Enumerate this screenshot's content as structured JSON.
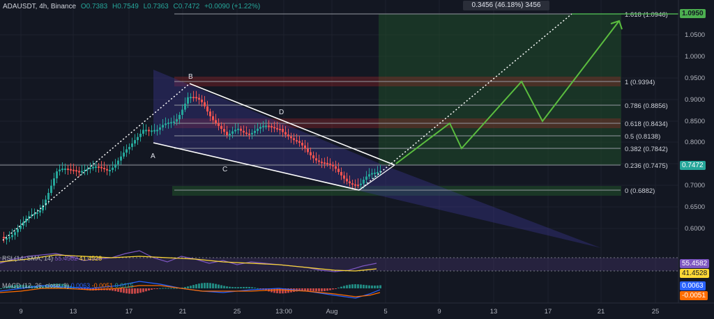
{
  "header": {
    "symbol": "ADAUSDT, 4h, Binance",
    "open": "O0.7383",
    "high": "H0.7549",
    "low": "L0.7363",
    "close": "C0.7472",
    "change": "+0.0090 (+1.22%)"
  },
  "measure_label": "0.3456 (46.18%) 3456",
  "price_axis": {
    "ticks": [
      "1.0500",
      "1.0000",
      "0.9500",
      "0.9000",
      "0.8500",
      "0.8000",
      "0.7500",
      "0.7000",
      "0.6500",
      "0.6000"
    ],
    "target_tag": "1.0950",
    "price_tag": "0.7472",
    "rsi_tag": "55.4582",
    "rsi_ma_tag": "41.4528",
    "macd_tag": "0.0063",
    "signal_tag": "-0.0051"
  },
  "time_axis": {
    "ticks": [
      "9",
      "13",
      "17",
      "21",
      "25",
      "13:00",
      "Aug",
      "5",
      "9",
      "13",
      "17",
      "21",
      "25"
    ]
  },
  "fib": [
    {
      "label": "1.618 (1.0946)"
    },
    {
      "label": "1 (0.9394)"
    },
    {
      "label": "0.786 (0.8856)"
    },
    {
      "label": "0.618 (0.8434)"
    },
    {
      "label": "0.5 (0.8138)"
    },
    {
      "label": "0.382 (0.7842)"
    },
    {
      "label": "0.236 (0.7475)"
    },
    {
      "label": "0 (0.6882)"
    }
  ],
  "points": {
    "A": "A",
    "B": "B",
    "C": "C",
    "D": "D"
  },
  "rsi": {
    "label": "RSI (14, SMA, 14)",
    "value1": "55.4582",
    "value2": "41.4528"
  },
  "macd": {
    "label": "MACD (12, 26, close, 9)",
    "value1": "0.0063",
    "value2": "-0.0051",
    "value3": "0.0115"
  },
  "colors": {
    "background": "#131722",
    "up": "#26a69a",
    "down": "#ef5350",
    "target": "#4caf50",
    "projection": "#5bbd3f",
    "rsi": "#7e57c2",
    "rsi_ma": "#fdd835",
    "macd": "#2962ff",
    "signal": "#ff6d00"
  }
}
